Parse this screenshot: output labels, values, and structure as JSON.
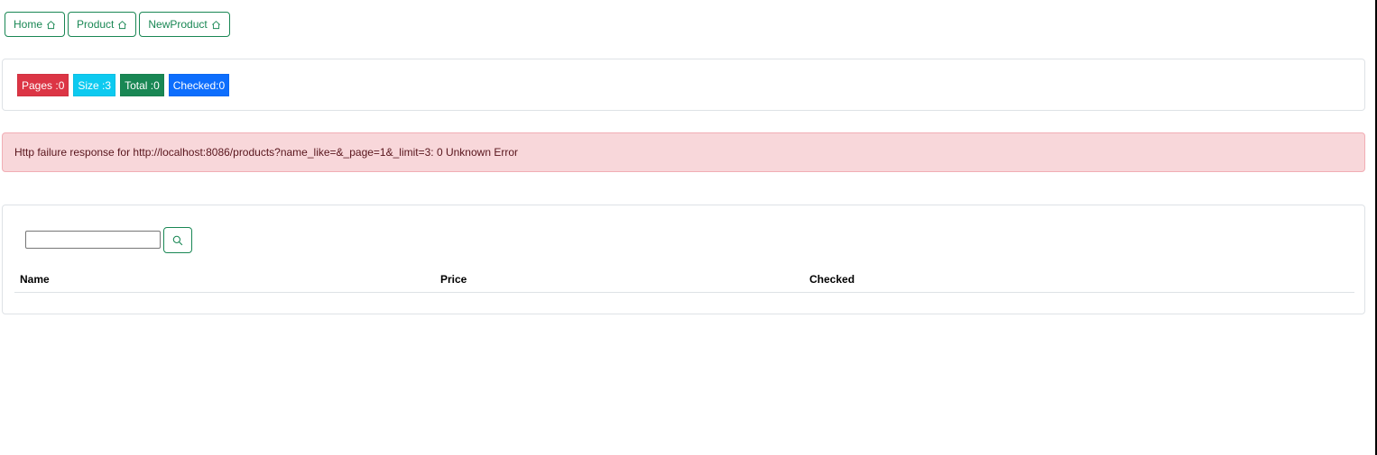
{
  "nav": {
    "items": [
      {
        "label": "Home",
        "icon": "house-icon"
      },
      {
        "label": "Product",
        "icon": "house-icon"
      },
      {
        "label": "NewProduct",
        "icon": "house-icon"
      }
    ],
    "color": "#198754"
  },
  "stats": {
    "pages": {
      "label": "Pages :0",
      "color": "#dc3545"
    },
    "size": {
      "label": "Size :3",
      "color": "#0dcaf0"
    },
    "total": {
      "label": "Total :0",
      "color": "#198754"
    },
    "checked": {
      "label": "Checked:0",
      "color": "#0d6efd"
    }
  },
  "alert": {
    "message": "Http failure response for http://localhost:8086/products?name_like=&_page=1&_limit=3: 0 Unknown Error",
    "background": "#f8d7da"
  },
  "search": {
    "value": "",
    "placeholder": "",
    "button_icon": "search-icon"
  },
  "table": {
    "columns": [
      "Name",
      "Price",
      "Checked"
    ],
    "rows": []
  }
}
